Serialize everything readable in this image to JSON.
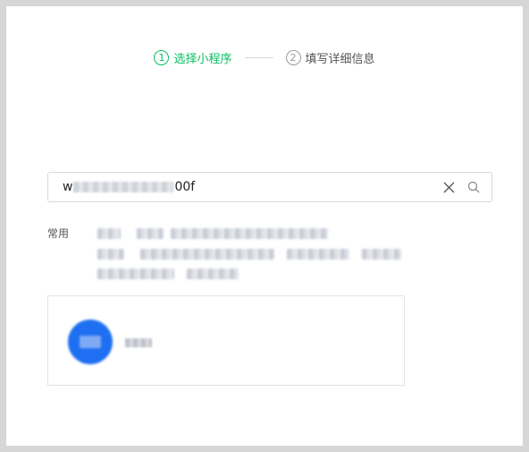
{
  "steps": [
    {
      "num": "1",
      "label": "选择小程序"
    },
    {
      "num": "2",
      "label": "填写详细信息"
    }
  ],
  "search": {
    "value_prefix": "w",
    "value_suffix": "00f",
    "clear_icon": "close-icon",
    "search_icon": "search-icon"
  },
  "common": {
    "label": "常用"
  },
  "colors": {
    "accent": "#07c160",
    "avatar": "#1e6ff1"
  }
}
